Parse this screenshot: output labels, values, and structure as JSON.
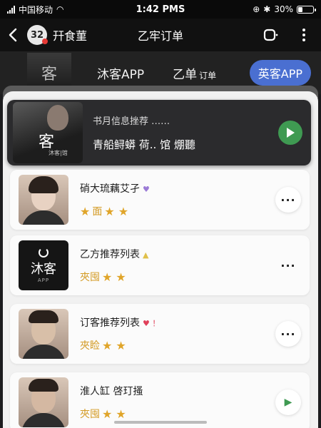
{
  "status_bar": {
    "carrier": "中国移动",
    "time": "1:42 PMS",
    "battery": "30%"
  },
  "nav": {
    "avatar_text": "32",
    "account_name": "幵食菫",
    "title": "乙牢订单"
  },
  "tabs": {
    "thumb_text": "客",
    "tab1": "沐客APP",
    "tab2": "乙单",
    "tab2_sub": "订单",
    "tab3": "英客APP"
  },
  "featured": {
    "brand": "客",
    "brand_sub": "沐客|馆",
    "label": "书月信息挫荐 ……",
    "subtitle": "青船鲟蟒 荷.. 馆  焩聽",
    "accent": "#3f9a52"
  },
  "items": [
    {
      "title": "硝大琉藕艾孑",
      "mark": "♥",
      "meta": "面",
      "stars": "★ ★",
      "action": "···"
    },
    {
      "title": "乙方推荐列表",
      "mark": "▲",
      "meta": "夾囤",
      "stars": "★ ★",
      "action": "···",
      "logo_main": "沐客",
      "logo_sub": "APP"
    },
    {
      "title": "订客推荐列表",
      "mark": "♥ ！",
      "meta": "夾睑",
      "stars": "★ ★",
      "action": "···"
    },
    {
      "title": "淮人缸 啓玎搔",
      "mark": "",
      "meta": "夾囤",
      "stars": "★ ★",
      "action": "▶"
    }
  ],
  "colors": {
    "star": "#e0a52a",
    "pill": "#4a6fd1"
  }
}
